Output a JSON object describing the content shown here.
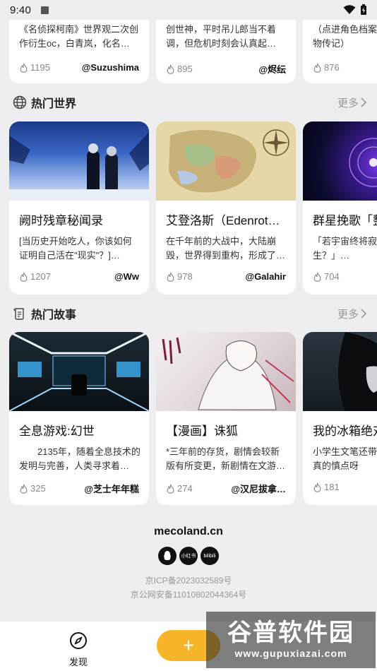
{
  "status_bar": {
    "time": "9:40"
  },
  "top_cards": [
    {
      "desc": "《名侦探柯南》世界观二次创作衍生oc，白青岚，化名…",
      "likes": "1195",
      "author": "@Suzushima"
    },
    {
      "desc": "创世神，平时吊儿郎当不着调，但危机时刻会认真起…",
      "likes": "895",
      "author": "@烬纭"
    },
    {
      "desc": "（点进角色档案可以曲还有人物传记）",
      "likes": "876",
      "author": ""
    }
  ],
  "hot_worlds": {
    "title": "热门世界",
    "more": "更多",
    "cards": [
      {
        "name": "阙时残章秘闻录",
        "desc": "[当历史开始吃人，你该如何证明自己活在\"现实\"？]…",
        "likes": "1207",
        "author": "@Ww"
      },
      {
        "name": "艾登洛斯（Edenrot…",
        "desc": "在千年前的大战中，大陆崩毁，世界得到重构，形成了…",
        "likes": "978",
        "author": "@Galahir"
      },
      {
        "name": "群星挽歌「整合",
        "desc": "「若宇宙终将寂灭，有星光诞生？」…",
        "likes": "704",
        "author": "@"
      }
    ]
  },
  "hot_stories": {
    "title": "热门故事",
    "more": "更多",
    "cards": [
      {
        "name": "全息游戏:幻世",
        "desc": "　　2135年，随着全息技术的发明与完善，人类寻求着…",
        "likes": "325",
        "author": "@芝士年年糕"
      },
      {
        "name": "【漫画】诛狐",
        "desc": "*三年前的存货，剧情会较新版有所变更，新剧情在文游…",
        "likes": "274",
        "author": "@汉尼拔拿…"
      },
      {
        "name": "我的冰箱绝对有",
        "desc": "小学生文笔还带了点病，真的真的慎点呀",
        "likes": "181",
        "author": ""
      }
    ]
  },
  "footer": {
    "site": "mecoland.cn",
    "socials": [
      "QQ",
      "小红书",
      "bilibili"
    ],
    "icp1": "京ICP备2023032589号",
    "icp2": "京公网安备11010802044364号"
  },
  "bottom_nav": {
    "discover_label": "发现",
    "fab_label": "+"
  },
  "watermark": {
    "line1": "谷普软件园",
    "line2": "www.gupuxiazai.com"
  },
  "colors": {
    "accent": "#f7b52a",
    "background": "#eeeef0"
  }
}
